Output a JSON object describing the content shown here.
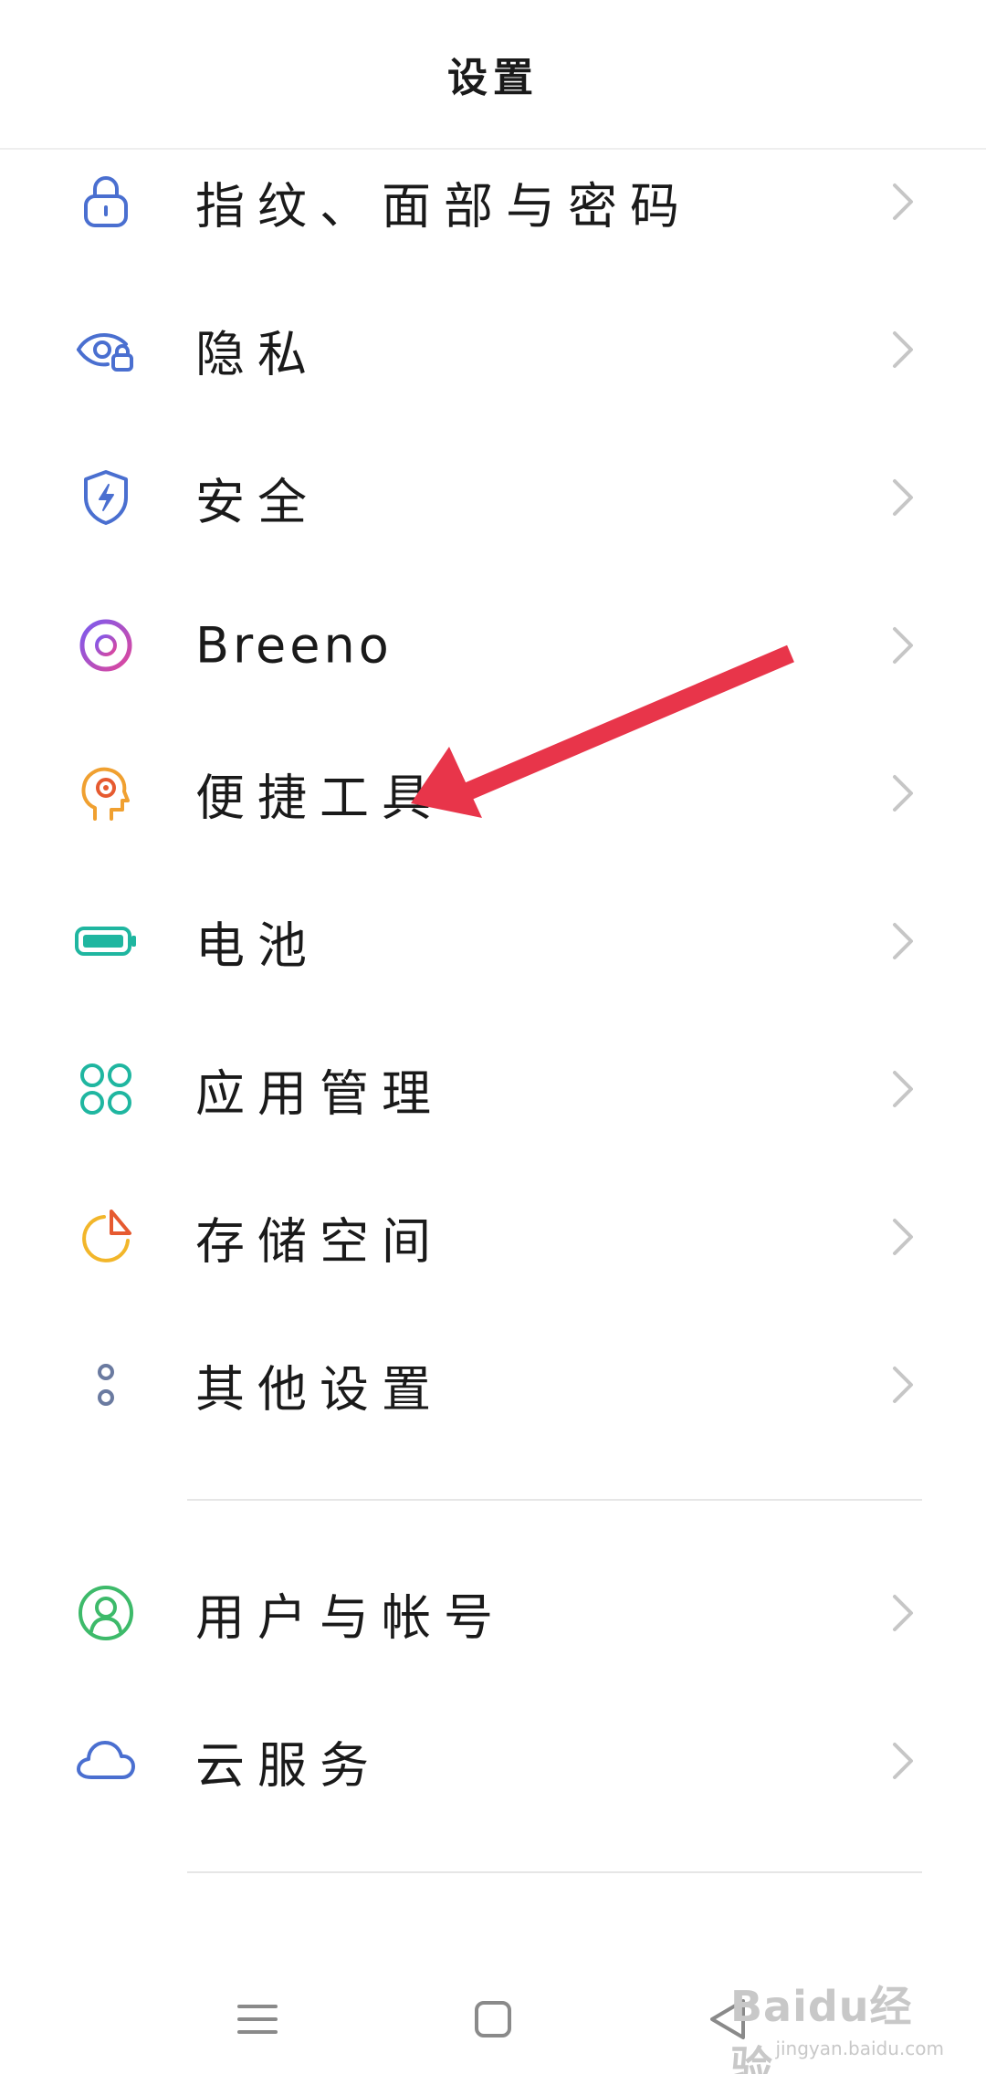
{
  "header": {
    "title": "设置"
  },
  "rows": [
    {
      "label": "指纹、面部与密码",
      "icon": "lock-icon"
    },
    {
      "label": "隐私",
      "icon": "privacy-eye-lock-icon"
    },
    {
      "label": "安全",
      "icon": "shield-bolt-icon"
    },
    {
      "label": "Breeno",
      "icon": "breeno-ring-icon"
    },
    {
      "label": "便捷工具",
      "icon": "head-target-icon"
    },
    {
      "label": "电池",
      "icon": "battery-icon"
    },
    {
      "label": "应用管理",
      "icon": "apps-grid-icon"
    },
    {
      "label": "存储空间",
      "icon": "storage-pie-icon"
    },
    {
      "label": "其他设置",
      "icon": "more-dots-icon"
    },
    {
      "label": "用户与帐号",
      "icon": "user-icon"
    },
    {
      "label": "云服务",
      "icon": "cloud-icon"
    }
  ],
  "watermark": {
    "main": "Baidu经验",
    "sub": "jingyan.baidu.com"
  },
  "colors": {
    "blue": "#4a6fd0",
    "purple": "#a05bd8",
    "orange": "#f0a030",
    "teal": "#1fb6a0",
    "yellow": "#f2b62a",
    "green": "#3dba6a",
    "arrow": "#e8354a"
  }
}
